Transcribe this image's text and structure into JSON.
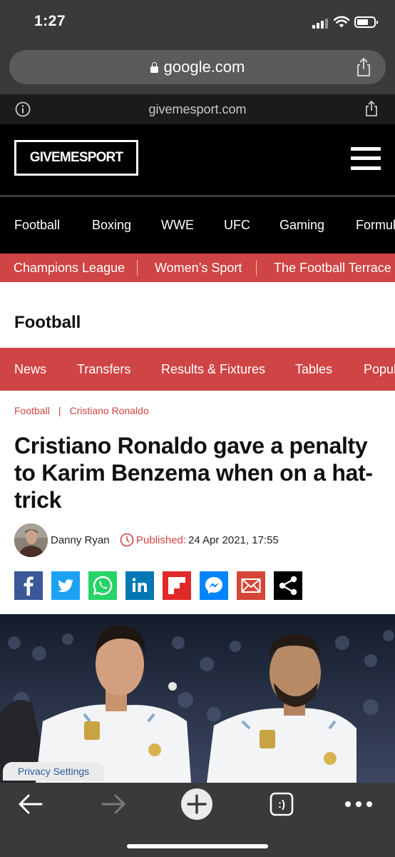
{
  "status_bar": {
    "time": "1:27"
  },
  "browser": {
    "url": "google.com",
    "site_host": "givemesport.com",
    "toolbar_tabs_label": ":)"
  },
  "site": {
    "logo": "GIVEMESPORT",
    "main_nav": [
      "Football",
      "Boxing",
      "WWE",
      "UFC",
      "Gaming",
      "Formul"
    ],
    "sub_nav": [
      "Champions League",
      "Women’s Sport",
      "The Football Terrace"
    ],
    "section_title": "Football",
    "section_tabs": [
      "News",
      "Transfers",
      "Results & Fixtures",
      "Tables",
      "Popul"
    ]
  },
  "article": {
    "breadcrumb": [
      "Football",
      "Cristiano Ronaldo"
    ],
    "breadcrumb_separator": "|",
    "headline": "Cristiano Ronaldo gave a penalty to Karim Benzema when on a hat-trick",
    "author": "Danny Ryan",
    "published_label": "Published:",
    "published_date": "24 Apr 2021, 17:55",
    "share_buttons": [
      "facebook",
      "twitter",
      "whatsapp",
      "linkedin",
      "flipboard",
      "messenger",
      "email",
      "share"
    ]
  },
  "privacy_settings": "Privacy Settings",
  "colors": {
    "brand_red": "#cf4444",
    "header_black": "#000000",
    "browser_chrome": "#3a3a3c",
    "facebook": "#3b5998",
    "twitter": "#1da1f2",
    "whatsapp": "#25d366",
    "linkedin": "#0077b5",
    "flipboard": "#e12828",
    "messenger": "#0084ff",
    "email": "#d44638",
    "share": "#000000"
  }
}
